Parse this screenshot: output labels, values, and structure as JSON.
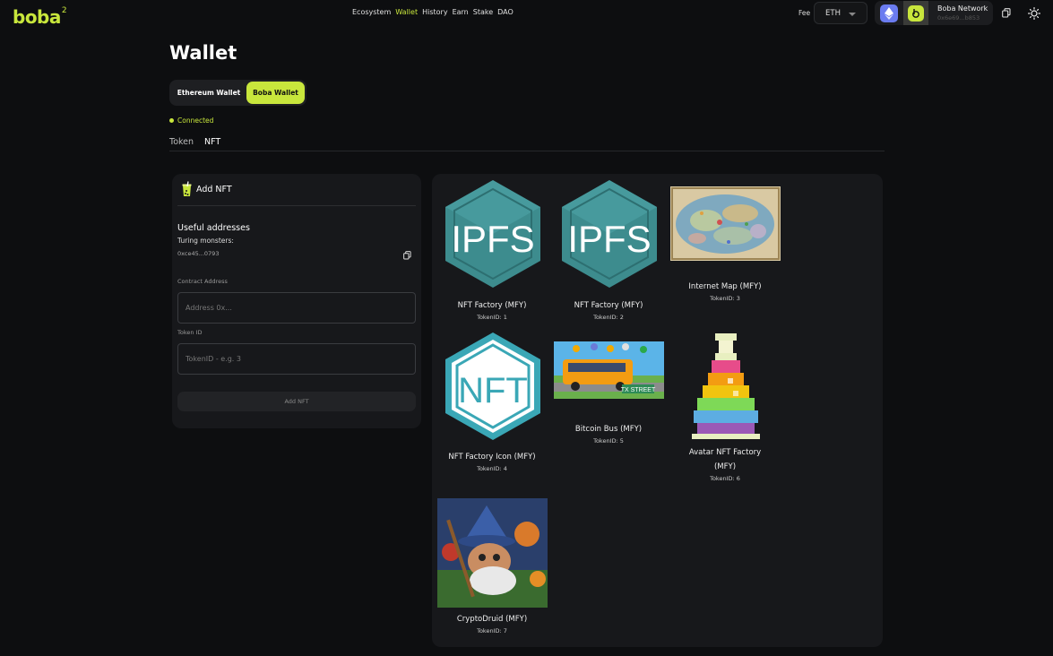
{
  "header": {
    "logo_text": "boba",
    "logo_superscript": "2",
    "nav": [
      "Ecosystem",
      "Wallet",
      "History",
      "Earn",
      "Stake",
      "DAO"
    ],
    "active_nav": "Wallet",
    "fee_label": "Fee",
    "fee_token": "ETH",
    "network_name": "Boba Network",
    "network_address": "0x6e69...b853"
  },
  "page": {
    "title": "Wallet",
    "wallet_toggle": {
      "ethereum": "Ethereum Wallet",
      "boba": "Boba Wallet"
    },
    "status": "Connected",
    "tabs": {
      "token": "Token",
      "nft": "NFT"
    }
  },
  "add_nft": {
    "title": "Add NFT",
    "useful_addresses": "Useful addresses",
    "turing_label": "Turing monsters:",
    "turing_address": "0xce45...0793",
    "contract_label": "Contract Address",
    "contract_placeholder": "Address 0x...",
    "token_label": "Token ID",
    "token_placeholder": "TokenID - e.g. 3",
    "button": "Add NFT"
  },
  "nfts": [
    {
      "name": "NFT Factory (MFY)",
      "token_id": "TokenID: 1",
      "image": "ipfs-hexagon"
    },
    {
      "name": "NFT Factory (MFY)",
      "token_id": "TokenID: 2",
      "image": "ipfs-hexagon"
    },
    {
      "name": "Internet Map (MFY)",
      "token_id": "TokenID: 3",
      "image": "internet-map"
    },
    {
      "name": "NFT Factory Icon (MFY)",
      "token_id": "TokenID: 4",
      "image": "nft-hexagon"
    },
    {
      "name": "Bitcoin Bus (MFY)",
      "token_id": "TokenID: 5",
      "image": "bitcoin-bus"
    },
    {
      "name": "Avatar NFT Factory",
      "name_line2": "(MFY)",
      "token_id": "TokenID: 6",
      "image": "pixel-potion"
    },
    {
      "name": "CryptoDruid (MFY)",
      "token_id": "TokenID: 7",
      "image": "crypto-druid"
    }
  ],
  "colors": {
    "accent": "#c8e63c",
    "background": "#0d0e10",
    "panel": "#17181b",
    "ipfs_teal": "#3d8c8e"
  }
}
